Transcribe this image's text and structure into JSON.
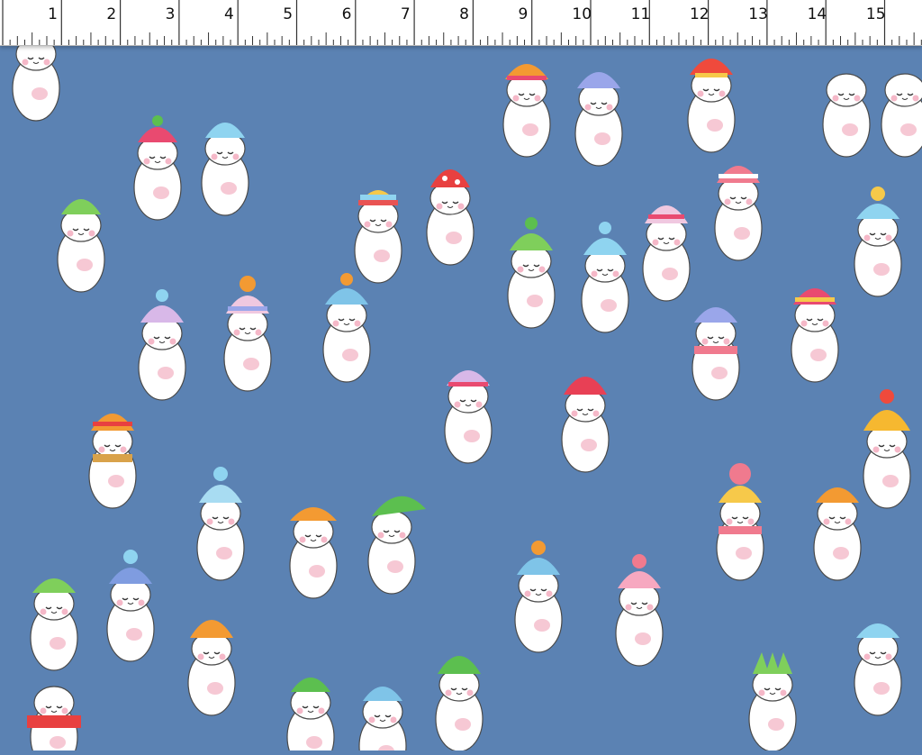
{
  "ruler": {
    "unit_labels": [
      "1",
      "2",
      "3",
      "4",
      "5",
      "6",
      "7",
      "8",
      "9",
      "10",
      "11",
      "12",
      "13",
      "14",
      "15"
    ]
  },
  "fabric": {
    "background_color": "#5b82b3",
    "motif": "cartoon-cats-wearing-knit-hats"
  }
}
